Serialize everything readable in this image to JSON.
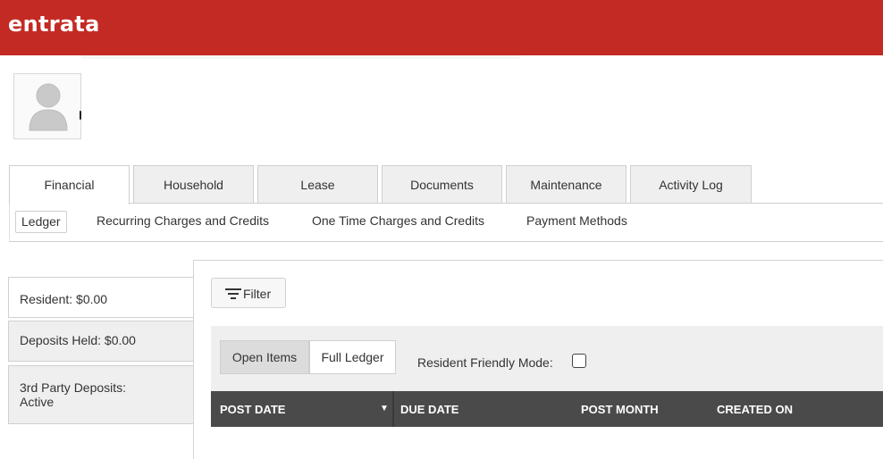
{
  "header": {
    "logo_text": "entrata",
    "brand_color": "#c42a24"
  },
  "profile": {
    "avatar_icon": "user-silhouette-icon"
  },
  "tabs": [
    {
      "label": "Financial",
      "active": true
    },
    {
      "label": "Household"
    },
    {
      "label": "Lease"
    },
    {
      "label": "Documents"
    },
    {
      "label": "Maintenance"
    },
    {
      "label": "Activity Log"
    }
  ],
  "subnav": [
    {
      "label": "Ledger",
      "active": true
    },
    {
      "label": "Recurring Charges and Credits"
    },
    {
      "label": "One Time Charges and Credits"
    },
    {
      "label": "Payment Methods"
    }
  ],
  "sidebar": [
    {
      "label": "Resident: $0.00",
      "active": true
    },
    {
      "label": "Deposits Held: $0.00"
    },
    {
      "label": "3rd Party Deposits:",
      "label2": "Active"
    }
  ],
  "ledger": {
    "filter_label": "Filter",
    "filter_icon": "filter-lines-icon",
    "view_options": [
      {
        "label": "Open Items",
        "selected": true
      },
      {
        "label": "Full Ledger",
        "selected": false
      }
    ],
    "resident_friendly_label": "Resident Friendly Mode:",
    "resident_friendly_checked": false,
    "columns": [
      "POST DATE",
      "DUE DATE",
      "POST MONTH",
      "CREATED ON"
    ],
    "sort_icon": "caret-down-icon"
  }
}
